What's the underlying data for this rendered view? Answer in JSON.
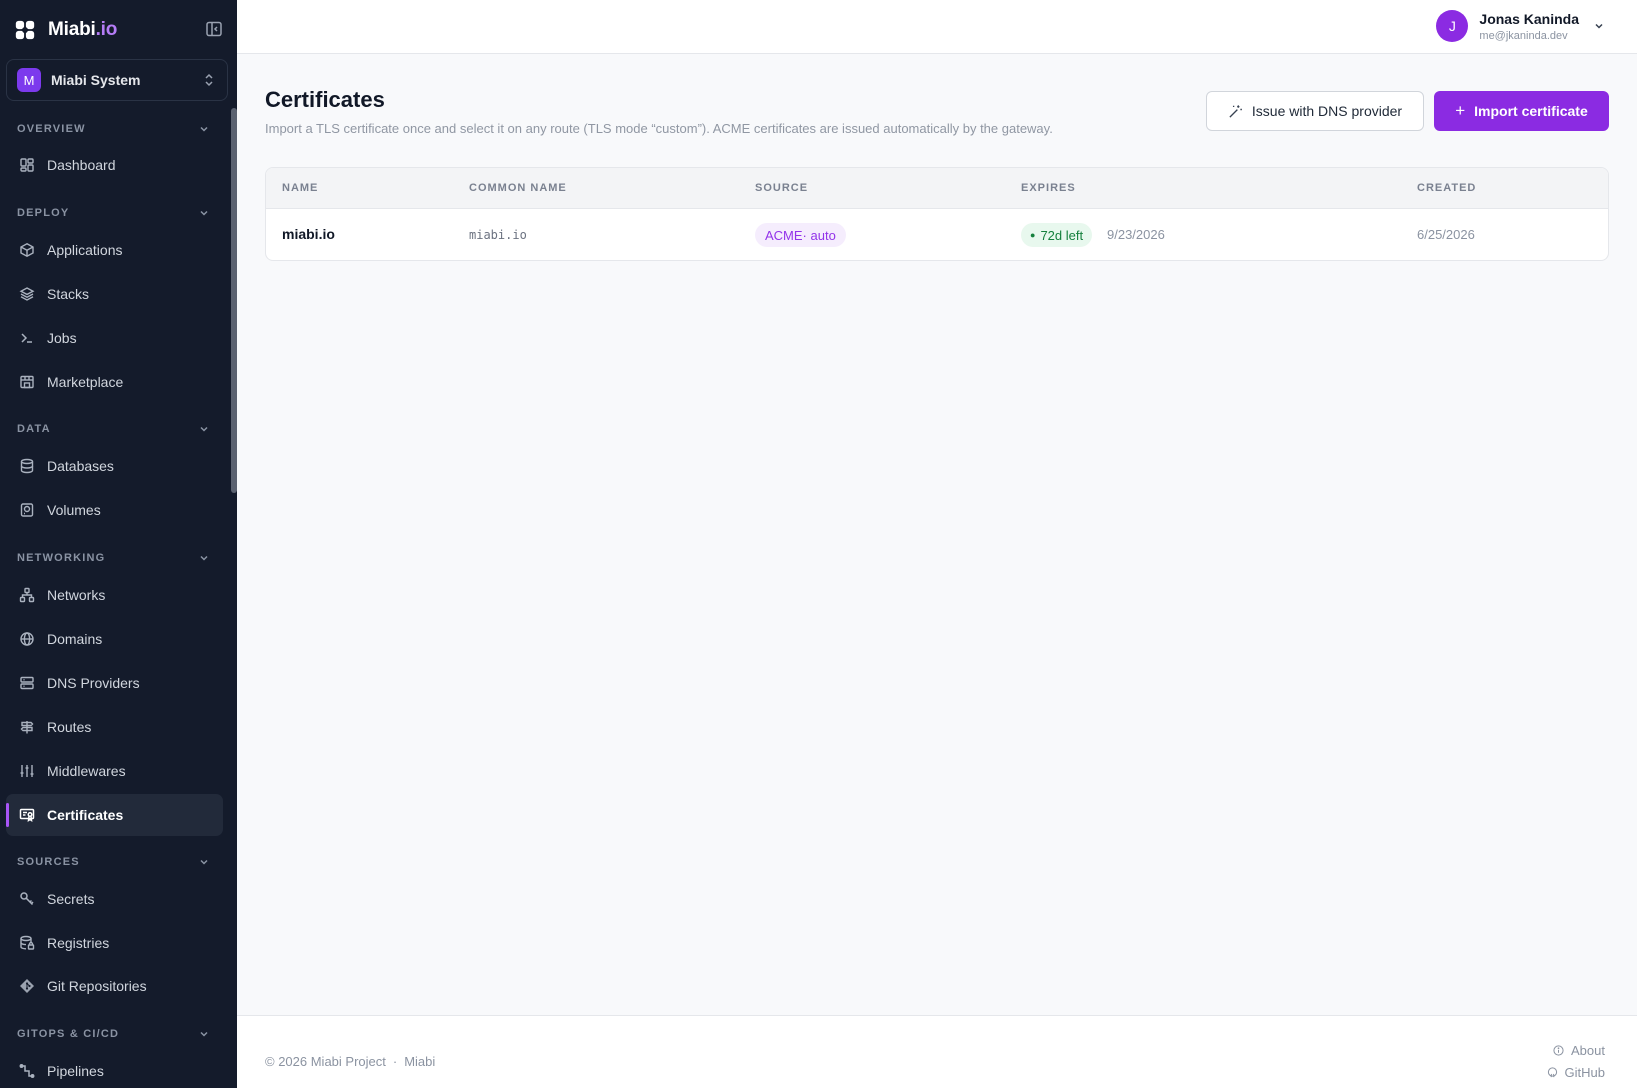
{
  "brand": {
    "name": "Miabi",
    "tld": ".io"
  },
  "org": {
    "initial": "M",
    "name": "Miabi System"
  },
  "sidebar": {
    "sections": [
      {
        "label": "OVERVIEW"
      },
      {
        "label": "DEPLOY"
      },
      {
        "label": "DATA"
      },
      {
        "label": "NETWORKING"
      },
      {
        "label": "SOURCES"
      },
      {
        "label": "GITOPS & CI/CD"
      }
    ],
    "items": [
      {
        "label": "Dashboard",
        "icon": "dashboard-icon"
      },
      {
        "label": "Applications",
        "icon": "cube-icon"
      },
      {
        "label": "Stacks",
        "icon": "layers-icon"
      },
      {
        "label": "Jobs",
        "icon": "terminal-icon"
      },
      {
        "label": "Marketplace",
        "icon": "store-icon"
      },
      {
        "label": "Databases",
        "icon": "database-icon"
      },
      {
        "label": "Volumes",
        "icon": "hard-drive-icon"
      },
      {
        "label": "Networks",
        "icon": "network-icon"
      },
      {
        "label": "Domains",
        "icon": "globe-icon"
      },
      {
        "label": "DNS Providers",
        "icon": "server-icon"
      },
      {
        "label": "Routes",
        "icon": "signpost-icon"
      },
      {
        "label": "Middlewares",
        "icon": "sliders-icon"
      },
      {
        "label": "Certificates",
        "icon": "certificate-icon",
        "active": true
      },
      {
        "label": "Secrets",
        "icon": "key-icon"
      },
      {
        "label": "Registries",
        "icon": "database-lock-icon"
      },
      {
        "label": "Git Repositories",
        "icon": "git-icon"
      },
      {
        "label": "Pipelines",
        "icon": "pipeline-icon"
      }
    ]
  },
  "user": {
    "initial": "J",
    "name": "Jonas Kaninda",
    "email": "me@jkaninda.dev"
  },
  "page": {
    "title": "Certificates",
    "subtitle": "Import a TLS certificate once and select it on any route (TLS mode “custom”). ACME certificates are issued automatically by the gateway.",
    "issue_button": "Issue with DNS provider",
    "import_button": "Import certificate",
    "import_plus": "+"
  },
  "table": {
    "columns": [
      "NAME",
      "COMMON NAME",
      "SOURCE",
      "EXPIRES",
      "CREATED"
    ],
    "rows": [
      {
        "name": "miabi.io",
        "common_name": "miabi.io",
        "source": "ACME· auto",
        "expires_badge": "72d left",
        "expires_date": "9/23/2026",
        "created": "6/25/2026"
      }
    ]
  },
  "footer": {
    "copyright": "© 2026 Miabi Project",
    "separator": "·",
    "product": "Miabi",
    "about": "About",
    "github": "GitHub"
  },
  "colors": {
    "sidebar_bg": "#141b2b",
    "accent": "#8b2be2",
    "success": "#15803d"
  }
}
